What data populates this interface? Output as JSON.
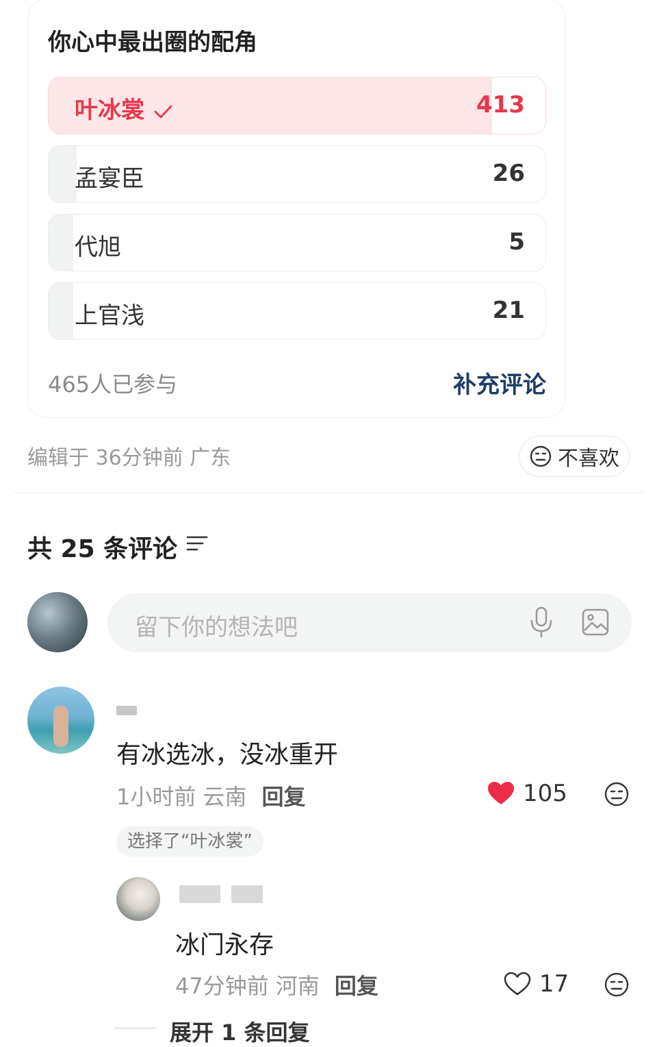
{
  "poll": {
    "title": "你心中最出圈的配角",
    "options": [
      {
        "label": "叶冰裳",
        "count": "413",
        "selected": true,
        "fraction": 0.892
      },
      {
        "label": "孟宴臣",
        "count": "26",
        "selected": false,
        "fraction": 0.056
      },
      {
        "label": "代旭",
        "count": "5",
        "selected": false,
        "fraction": 0.011
      },
      {
        "label": "上官浅",
        "count": "21",
        "selected": false,
        "fraction": 0.045
      }
    ],
    "participants": "465人已参与",
    "add_comment": "补充评论"
  },
  "post_meta": {
    "edited": "编辑于 36分钟前 广东",
    "dislike": "不喜欢"
  },
  "comments_header": {
    "count_label": "共 25 条评论"
  },
  "input": {
    "placeholder": "留下你的想法吧"
  },
  "comment1": {
    "text": "有冰选冰，没冰重开",
    "meta": "1小时前 云南",
    "reply": "回复",
    "likes": "105",
    "liked": true,
    "vote_badge": "选择了“叶冰裳”"
  },
  "reply1": {
    "text": "冰门永存",
    "meta": "47分钟前 河南",
    "reply": "回复",
    "likes": "17"
  },
  "expand": "展开 1 条回复",
  "colors": {
    "accent_red": "#e8374b",
    "link_blue": "#1f3d6b",
    "muted": "#9a9a9a"
  }
}
